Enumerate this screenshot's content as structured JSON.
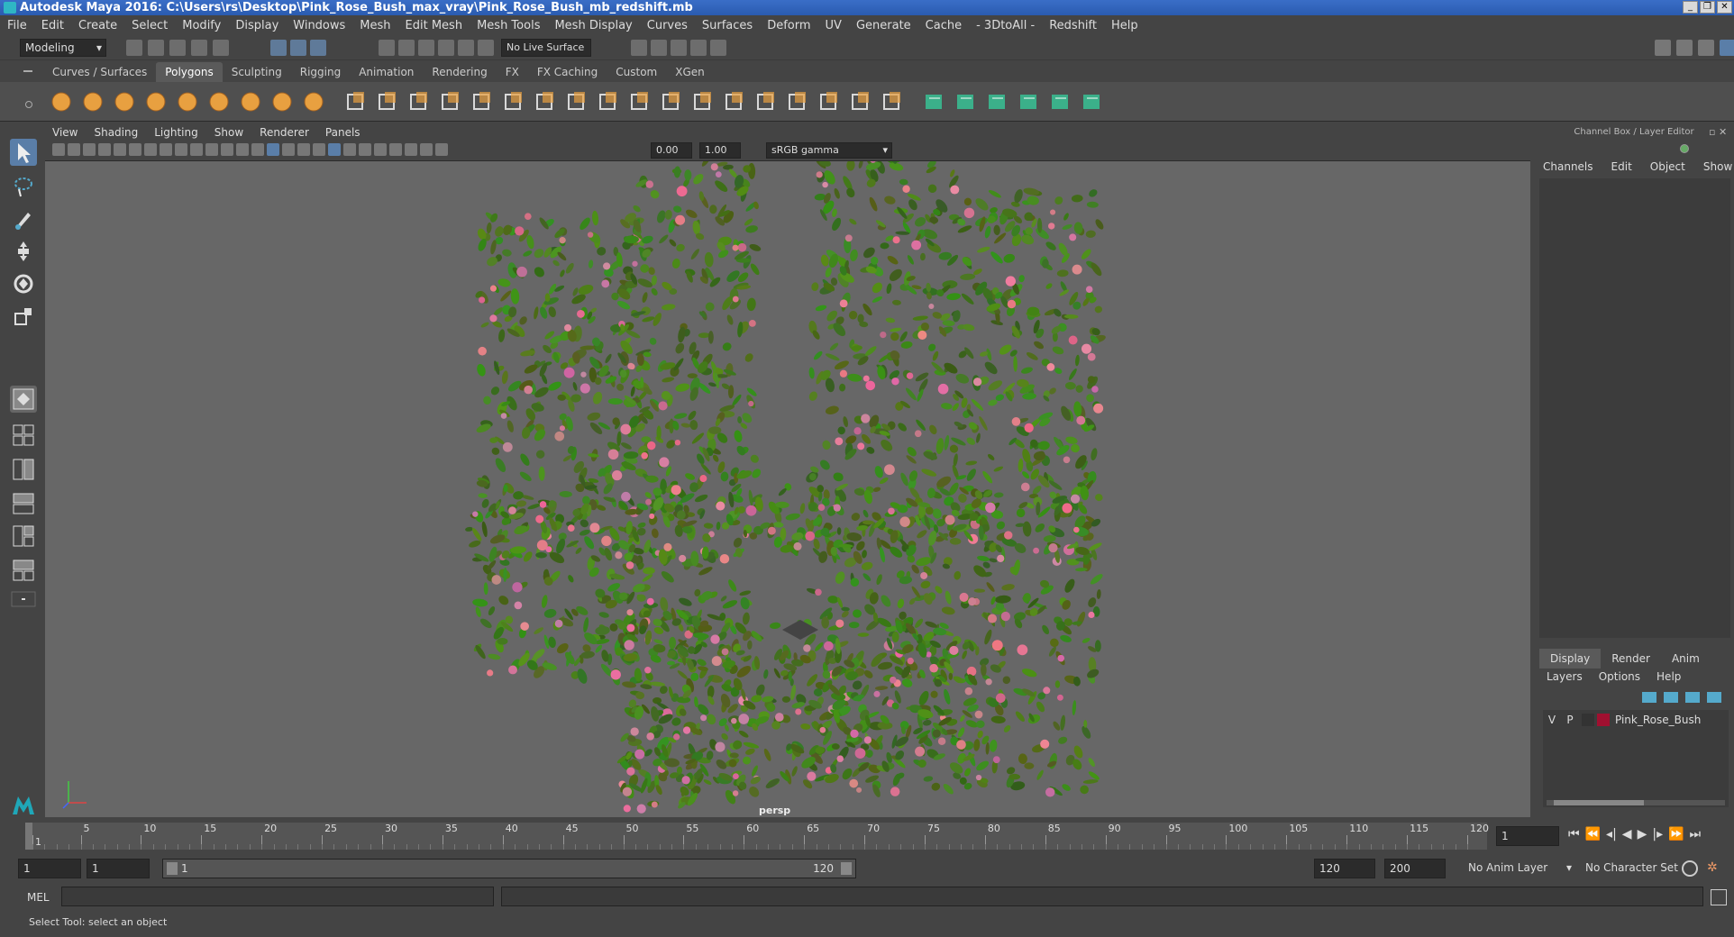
{
  "title": "Autodesk Maya 2016: C:\\Users\\rs\\Desktop\\Pink_Rose_Bush_max_vray\\Pink_Rose_Bush_mb_redshift.mb",
  "menus": [
    "File",
    "Edit",
    "Create",
    "Select",
    "Modify",
    "Display",
    "Windows",
    "Mesh",
    "Edit Mesh",
    "Mesh Tools",
    "Mesh Display",
    "Curves",
    "Surfaces",
    "Deform",
    "UV",
    "Generate",
    "Cache",
    "- 3DtoAll -",
    "Redshift",
    "Help"
  ],
  "status": {
    "mode": "Modeling",
    "live_surface": "No Live Surface"
  },
  "shelf_tabs": [
    "Curves / Surfaces",
    "Polygons",
    "Sculpting",
    "Rigging",
    "Animation",
    "Rendering",
    "FX",
    "FX Caching",
    "Custom",
    "XGen"
  ],
  "shelf_active": "Polygons",
  "panel_menus": [
    "View",
    "Shading",
    "Lighting",
    "Show",
    "Renderer",
    "Panels"
  ],
  "panel_tools": {
    "exposure": "0.00",
    "gamma": "1.00",
    "colorspace": "sRGB gamma"
  },
  "viewport": {
    "camera": "persp"
  },
  "channel_box": {
    "header": "Channel Box / Layer Editor",
    "tabs": [
      "Channels",
      "Edit",
      "Object",
      "Show"
    ]
  },
  "layer_editor": {
    "tabs": [
      "Display",
      "Render",
      "Anim"
    ],
    "active": "Display",
    "menus": [
      "Layers",
      "Options",
      "Help"
    ],
    "layer": {
      "v": "V",
      "p": "P",
      "name": "Pink_Rose_Bush",
      "color": "#a01030"
    }
  },
  "timeline": {
    "ticks": [
      "1",
      "5",
      "10",
      "15",
      "20",
      "25",
      "30",
      "35",
      "40",
      "45",
      "50",
      "55",
      "60",
      "65",
      "70",
      "75",
      "80",
      "85",
      "90",
      "95",
      "100",
      "105",
      "110",
      "115",
      "120"
    ],
    "current": "1"
  },
  "range": {
    "start": "1",
    "start2": "1",
    "slider_start": "1",
    "slider_end": "120",
    "end": "120",
    "end2": "200",
    "anim_layer": "No Anim Layer",
    "char_set": "No Character Set"
  },
  "cmd": {
    "lang": "MEL"
  },
  "help": "Select Tool: select an object"
}
